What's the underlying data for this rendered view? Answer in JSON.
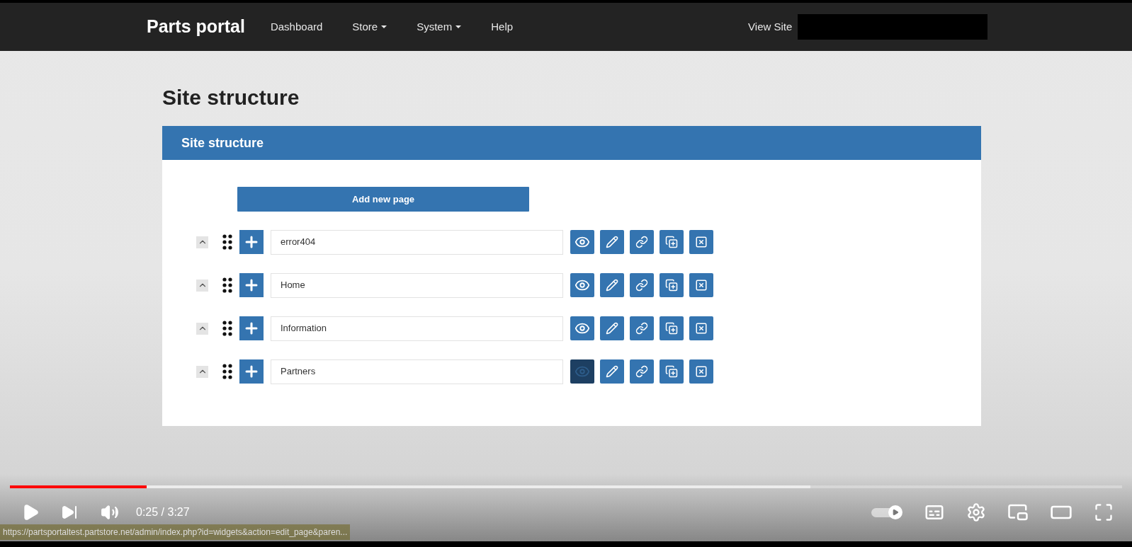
{
  "navbar": {
    "brand": "Parts portal",
    "items": [
      {
        "label": "Dashboard",
        "dropdown": false
      },
      {
        "label": "Store",
        "dropdown": true
      },
      {
        "label": "System",
        "dropdown": true
      },
      {
        "label": "Help",
        "dropdown": false
      }
    ],
    "view_site": "View Site"
  },
  "page": {
    "title": "Site structure"
  },
  "panel": {
    "title": "Site structure",
    "add_button": "Add new page",
    "rows": [
      {
        "name": "error404",
        "eye_pressed": false
      },
      {
        "name": "Home",
        "eye_pressed": false
      },
      {
        "name": "Information",
        "eye_pressed": false
      },
      {
        "name": "Partners",
        "eye_pressed": true
      }
    ]
  },
  "player": {
    "progress": {
      "level": 0.123
    },
    "buffer": {
      "level": 0.72
    },
    "time": "0:25 / 3:27",
    "autoplay": {
      "on": true
    }
  },
  "status_bar": {
    "url": "https://partsportaltest.partstore.net/admin/index.php?id=widgets&action=edit_page&paren..."
  }
}
